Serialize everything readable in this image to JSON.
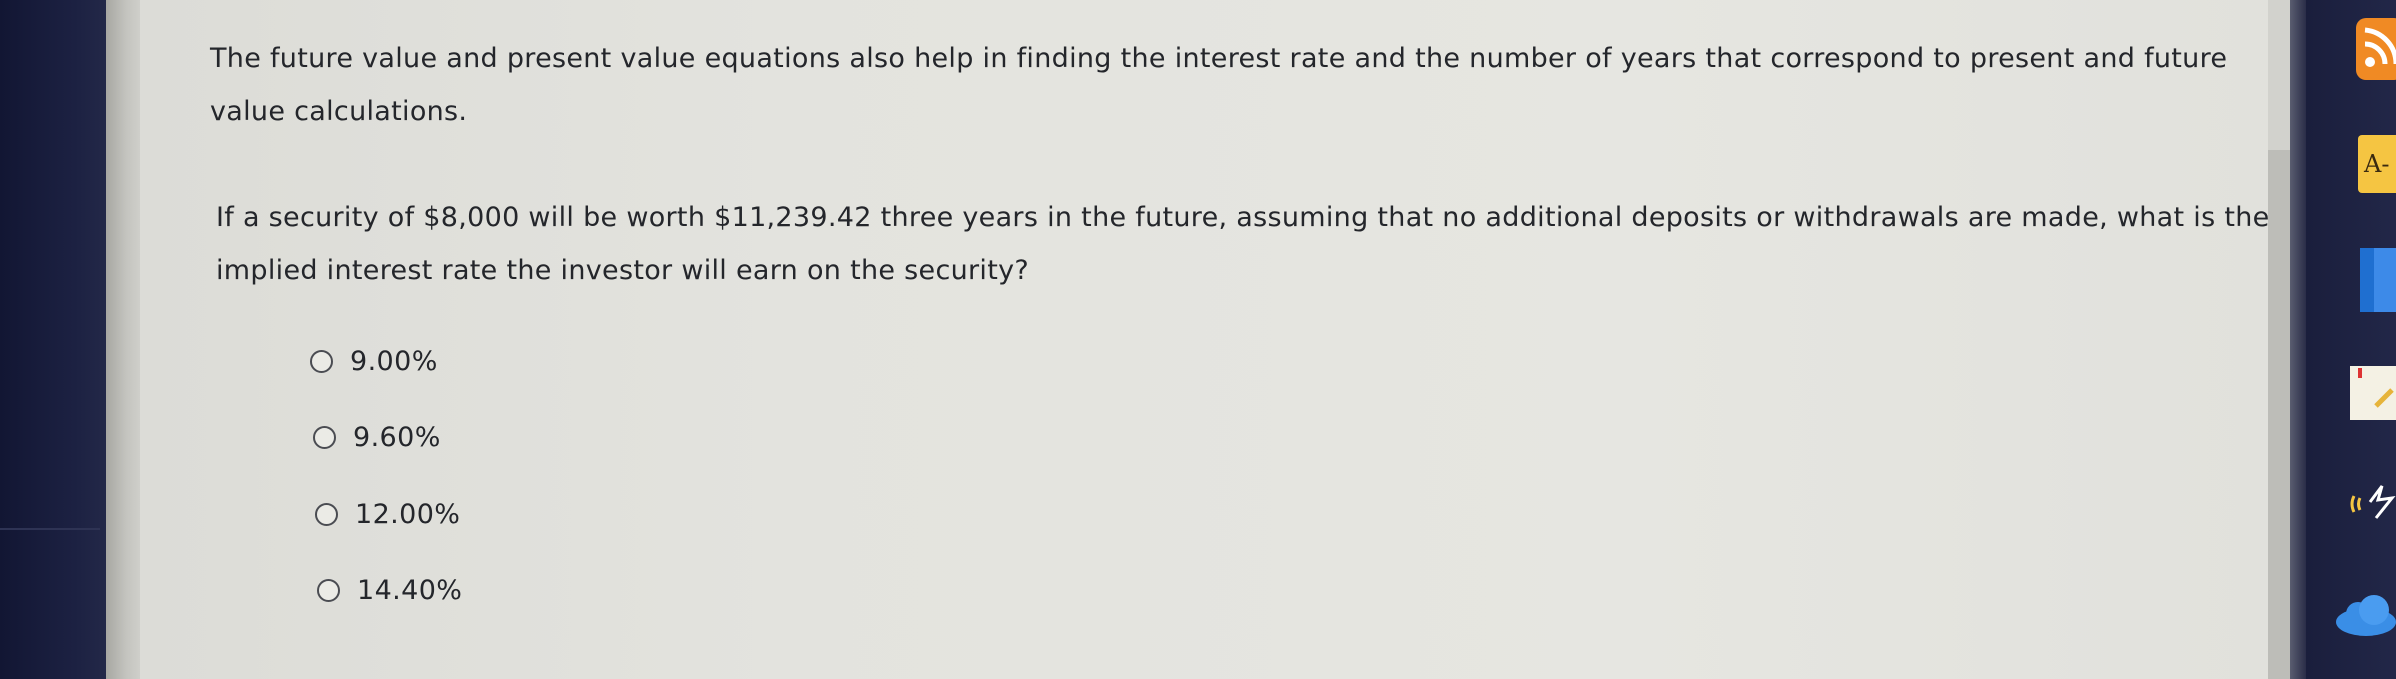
{
  "question": {
    "intro": "The future value and present value equations also help in finding the interest rate and the number of years that correspond to present and future value calculations.",
    "prompt": "If a security of $8,000 will be worth $11,239.42 three years in the future, assuming that no additional deposits or withdrawals are made, what is the implied interest rate the investor will earn on the security?",
    "options": [
      {
        "label": "9.00%",
        "selected": false
      },
      {
        "label": "9.60%",
        "selected": false
      },
      {
        "label": "12.00%",
        "selected": false
      },
      {
        "label": "14.40%",
        "selected": false
      }
    ]
  },
  "dock": {
    "icons": [
      "rss-icon",
      "dictionary-icon",
      "book-icon",
      "notepad-icon",
      "wifi-signal-icon",
      "cloud-icon"
    ],
    "dictionary_label": "A-"
  },
  "colors": {
    "page_background": "#e6e6e1",
    "text": "#24262b",
    "dock_background": "#1a1e3c",
    "rss_orange": "#f08a24",
    "dictionary_yellow": "#f5c542",
    "book_blue": "#1f6fd0",
    "cloud_blue": "#3a8ee6"
  }
}
